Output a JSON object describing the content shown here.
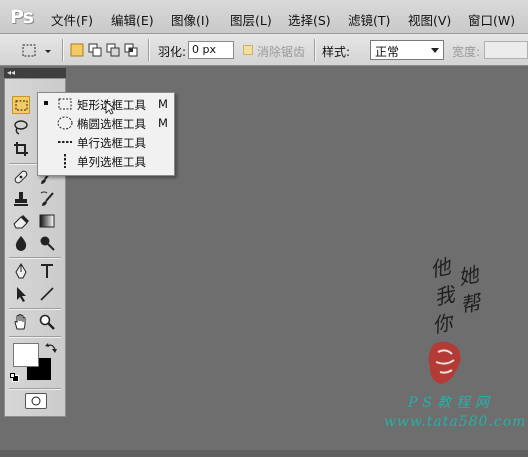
{
  "app": {
    "logo": "Ps"
  },
  "menu": [
    "文件(F)",
    "编辑(E)",
    "图像(I)",
    "图层(L)",
    "选择(S)",
    "滤镜(T)",
    "视图(V)",
    "窗口(W)"
  ],
  "options": {
    "feather_label": "羽化:",
    "feather_value": "0 px",
    "antialias_label": "消除锯齿",
    "style_label": "样式:",
    "style_value": "正常",
    "width_label": "宽度:"
  },
  "panel_strip": {
    "collapse_glyph": "◂◂"
  },
  "flyout": [
    {
      "label": "矩形选框工具",
      "shortcut": "M",
      "selected": true,
      "icon": "rect-marquee-icon"
    },
    {
      "label": "椭圆选框工具",
      "shortcut": "M",
      "selected": false,
      "icon": "ellipse-marquee-icon"
    },
    {
      "label": "单行选框工具",
      "shortcut": "",
      "selected": false,
      "icon": "single-row-marquee-icon"
    },
    {
      "label": "单列选框工具",
      "shortcut": "",
      "selected": false,
      "icon": "single-column-marquee-icon"
    }
  ],
  "watermark": {
    "chars": [
      "他",
      "她",
      "我",
      "帮",
      "你"
    ],
    "site_name": "PS教程网",
    "url": "www.tata580.com"
  },
  "colors": {
    "canvas": "#6e6e6e",
    "active_tool": "#f4ca63",
    "watermark_text": "#26b0a8",
    "seal": "#c0312b"
  }
}
